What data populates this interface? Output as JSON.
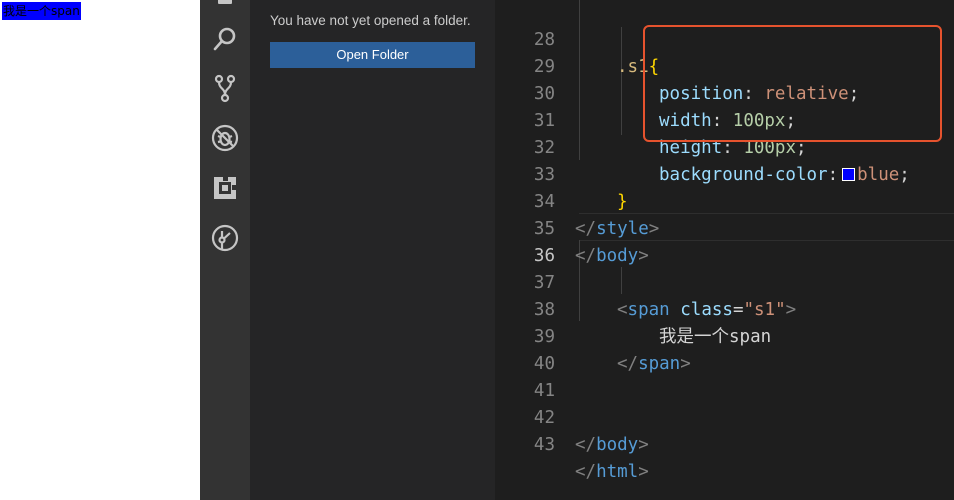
{
  "preview": {
    "span_text": "我是一个span",
    "span_background": "#0000ff"
  },
  "activity_bar": {
    "icons": [
      "explorer-icon",
      "search-icon",
      "source-control-icon",
      "debug-disabled-icon",
      "extensions-icon",
      "git-graph-icon"
    ]
  },
  "sidebar": {
    "message": "You have not yet opened a folder.",
    "open_folder_label": "Open Folder",
    "button_color": "#2c5f99"
  },
  "editor": {
    "active_line": "36",
    "highlight_color": "#e6532e",
    "lines": [
      {
        "num": "28",
        "selector": ".s1",
        "brace": "{"
      },
      {
        "num": "29",
        "prop": "position",
        "colon": ":",
        "value": "relative",
        "semi": ";"
      },
      {
        "num": "30",
        "prop": "width",
        "colon": ":",
        "value": "100px",
        "semi": ";"
      },
      {
        "num": "31",
        "prop": "height",
        "colon": ":",
        "value": "100px",
        "semi": ";"
      },
      {
        "num": "32",
        "prop": "background-color",
        "colon": ":",
        "value": "blue",
        "semi": ";"
      },
      {
        "num": "33",
        "brace": "}"
      },
      {
        "num": "34",
        "open": "</",
        "tag": "style",
        "close": ">"
      },
      {
        "num": "35",
        "open": "</",
        "tag": "body",
        "close": ">"
      },
      {
        "num": "36"
      },
      {
        "num": "37",
        "open": "<",
        "tag": "span",
        "attr": "class",
        "eq": "=",
        "attr_value": "\"s1\"",
        "close": ">"
      },
      {
        "num": "38",
        "text": "我是一个span"
      },
      {
        "num": "39",
        "open": "</",
        "tag": "span",
        "close": ">"
      },
      {
        "num": "40"
      },
      {
        "num": "41"
      },
      {
        "num": "42",
        "open": "</",
        "tag": "body",
        "close": ">"
      },
      {
        "num": "43",
        "open": "</",
        "tag": "html",
        "close": ">"
      }
    ]
  }
}
